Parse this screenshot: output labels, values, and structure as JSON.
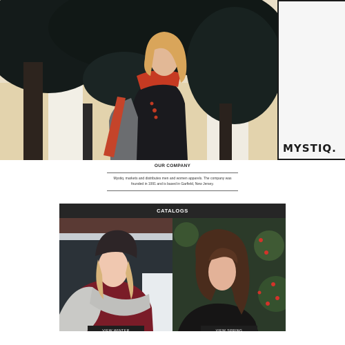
{
  "hero": {
    "brand": "MYSTIQ.",
    "image": "woman-with-backpack-and-red-scarf-photo"
  },
  "company": {
    "title": "OUR COMPANY",
    "body": "Mystiq. markets and distributes men and women apparels. The company was founded in 1991 and is based in Garfield, New Jersey."
  },
  "catalogs": {
    "title": "CATALOGS",
    "items": [
      {
        "button": "VIEW WINTER",
        "image": "woman-in-beanie-and-scarf-photo"
      },
      {
        "button": "VIEW SPRING",
        "image": "curly-haired-woman-with-red-berries-photo"
      }
    ]
  },
  "colors": {
    "header_bg": "#262626",
    "button_bg": "#1e1e1e",
    "text": "#222222"
  }
}
